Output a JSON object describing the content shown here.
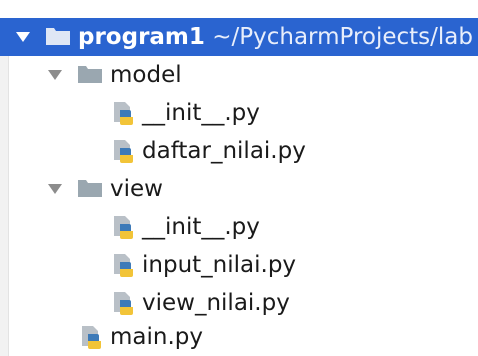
{
  "project_tree": {
    "root": {
      "name": "program1",
      "path": "~/PycharmProjects/lab",
      "expanded": true,
      "icon": "folder-icon"
    },
    "model": {
      "name": "model",
      "expanded": true,
      "icon": "folder-icon",
      "files": [
        {
          "name": "__init__.py",
          "icon": "python-file-icon"
        },
        {
          "name": "daftar_nilai.py",
          "icon": "python-file-icon"
        }
      ]
    },
    "view": {
      "name": "view",
      "expanded": true,
      "icon": "folder-icon",
      "files": [
        {
          "name": "__init__.py",
          "icon": "python-file-icon"
        },
        {
          "name": "input_nilai.py",
          "icon": "python-file-icon"
        },
        {
          "name": "view_nilai.py",
          "icon": "python-file-icon"
        }
      ]
    },
    "main_file": {
      "name": "main.py",
      "icon": "python-file-icon"
    }
  },
  "colors": {
    "selection": "#2a64d0",
    "folder": "#9aa7b0",
    "python_blue": "#3d7ab8",
    "python_yellow": "#f2c438",
    "file_page": "#b9c0c7"
  }
}
